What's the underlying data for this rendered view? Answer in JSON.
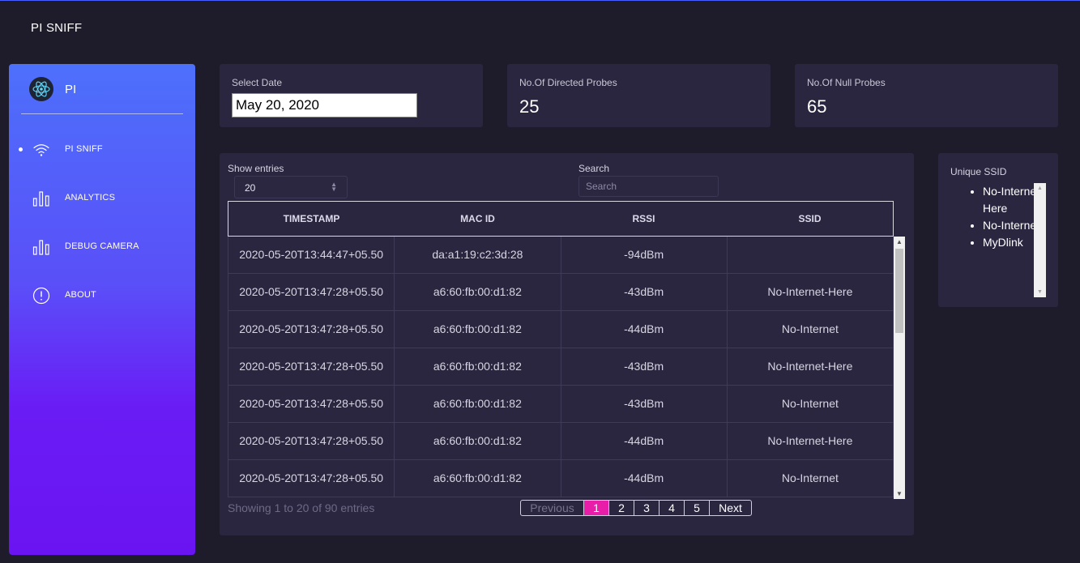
{
  "app": {
    "brand": "PI SNIFF"
  },
  "sidebar": {
    "title": "PI",
    "items": [
      {
        "label": "PI SNIFF",
        "icon": "wifi-icon",
        "active": true
      },
      {
        "label": "ANALYTICS",
        "icon": "bar-chart-icon",
        "active": false
      },
      {
        "label": "DEBUG CAMERA",
        "icon": "bar-chart-icon",
        "active": false
      },
      {
        "label": "ABOUT",
        "icon": "info-icon",
        "active": false
      }
    ]
  },
  "cards": {
    "date": {
      "label": "Select Date",
      "value": "May 20, 2020"
    },
    "directed": {
      "label": "No.Of Directed Probes",
      "value": "25"
    },
    "null": {
      "label": "No.Of Null Probes",
      "value": "65"
    }
  },
  "table": {
    "show_entries_label": "Show entries",
    "entries_value": "20",
    "search_label": "Search",
    "search_placeholder": "Search",
    "columns": [
      "TIMESTAMP",
      "MAC ID",
      "RSSI",
      "SSID"
    ],
    "rows": [
      [
        "2020-05-20T13:44:47+05.50",
        "da:a1:19:c2:3d:28",
        "-94dBm",
        ""
      ],
      [
        "2020-05-20T13:47:28+05.50",
        "a6:60:fb:00:d1:82",
        "-43dBm",
        "No-Internet-Here"
      ],
      [
        "2020-05-20T13:47:28+05.50",
        "a6:60:fb:00:d1:82",
        "-44dBm",
        "No-Internet"
      ],
      [
        "2020-05-20T13:47:28+05.50",
        "a6:60:fb:00:d1:82",
        "-43dBm",
        "No-Internet-Here"
      ],
      [
        "2020-05-20T13:47:28+05.50",
        "a6:60:fb:00:d1:82",
        "-43dBm",
        "No-Internet"
      ],
      [
        "2020-05-20T13:47:28+05.50",
        "a6:60:fb:00:d1:82",
        "-44dBm",
        "No-Internet-Here"
      ],
      [
        "2020-05-20T13:47:28+05.50",
        "a6:60:fb:00:d1:82",
        "-44dBm",
        "No-Internet"
      ]
    ],
    "info": "Showing 1 to 20 of 90 entries",
    "pagination": {
      "previous": "Previous",
      "pages": [
        "1",
        "2",
        "3",
        "4",
        "5"
      ],
      "active_page": "1",
      "next": "Next"
    }
  },
  "unique_ssid": {
    "title": "Unique SSID",
    "items": [
      "No-Internet-Here",
      "No-Internet",
      "MyDlink"
    ]
  },
  "colors": {
    "background": "#1e1b2b",
    "card": "#2a2640",
    "sidebar_top": "#4d70fb",
    "sidebar_bottom": "#6a14f2",
    "accent_page": "#e91ea8"
  }
}
